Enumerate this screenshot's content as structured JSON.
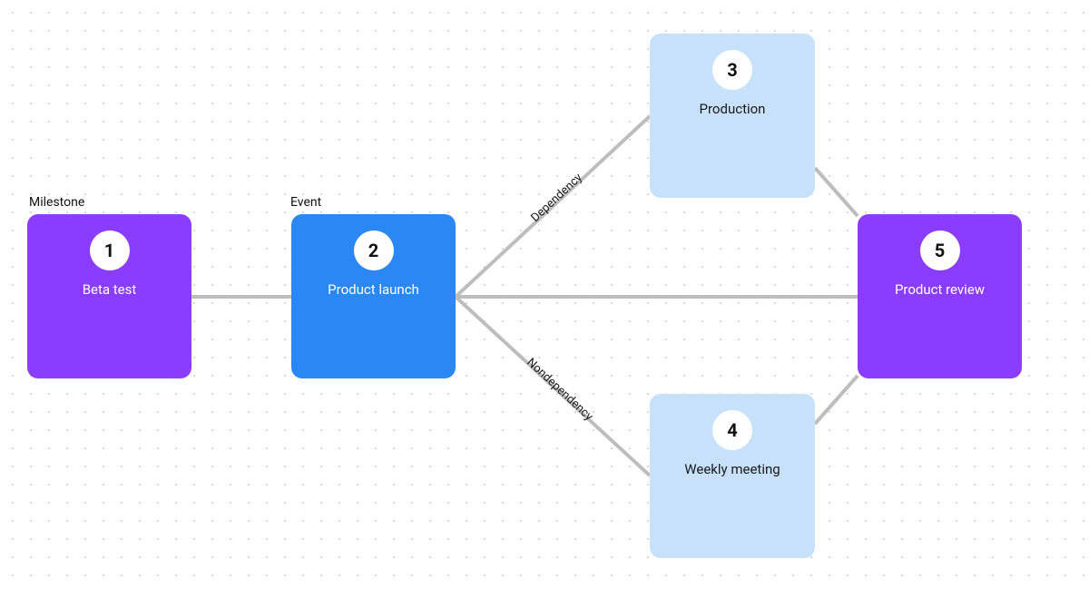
{
  "labels": {
    "milestone": "Milestone",
    "event": "Event"
  },
  "nodes": {
    "n1": {
      "number": "1",
      "title": "Beta test"
    },
    "n2": {
      "number": "2",
      "title": "Product launch"
    },
    "n3": {
      "number": "3",
      "title": "Production"
    },
    "n4": {
      "number": "4",
      "title": "Weekly meeting"
    },
    "n5": {
      "number": "5",
      "title": "Product review"
    }
  },
  "edges": {
    "e_dep": {
      "label": "Dependency"
    },
    "e_nondep": {
      "label": "Nondependency"
    }
  },
  "colors": {
    "purple": "#8b3dff",
    "blue": "#2b87f3",
    "lightblue": "#c8e1fa",
    "edge": "#bdbdbd"
  }
}
